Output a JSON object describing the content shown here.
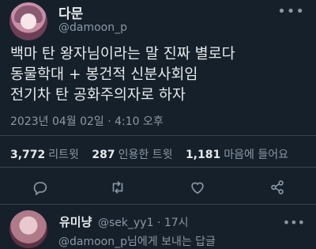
{
  "tweet": {
    "display_name": "다문",
    "handle": "@damoon_p",
    "text_lines": [
      "백마 탄 왕자님이라는 말 진짜 별로다",
      "동물학대 + 봉건적 신분사회임",
      "전기차 탄 공화주의자로 하자"
    ],
    "timestamp": "2023년 04월 02일 · 4:10 오후"
  },
  "stats": {
    "retweets_count": "3,772",
    "retweets_label": "리트윗",
    "quotes_count": "287",
    "quotes_label": "인용한 트윗",
    "likes_count": "1,181",
    "likes_label": "마음에 들어요"
  },
  "reply": {
    "display_name": "유미냥",
    "meta": "@sek_yy1 · 17시",
    "preview": "@damoon_p님에게 보내는 답글"
  },
  "icons": {
    "more": "more-horizontal-icon",
    "reply": "comment-icon",
    "retweet": "retweet-icon",
    "like": "heart-icon",
    "share": "share-icon"
  },
  "colors": {
    "background": "#15202b",
    "text": "#e7e9ea",
    "secondary": "#8b98a5",
    "divider": "#38444d"
  }
}
